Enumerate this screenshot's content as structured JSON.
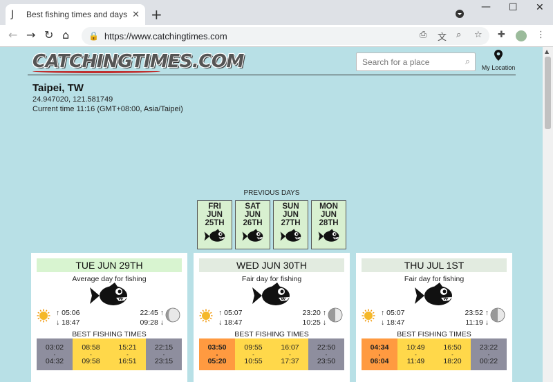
{
  "browser": {
    "tab_title": "Best fishing times and days | Catching",
    "tab_favicon": "fishhook-icon",
    "url": "https://www.catchingtimes.com"
  },
  "site": {
    "logo_text": "CATCHINGTIMES.COM",
    "search_placeholder": "Search for a place",
    "my_location_label": "My Location"
  },
  "location": {
    "name": "Taipei, TW",
    "coords": "24.947020, 121.581749",
    "current_time": "Current time 11:16 (GMT+08:00, Asia/Taipei)"
  },
  "previous_days": {
    "label": "PREVIOUS DAYS",
    "days": [
      {
        "day": "FRI",
        "month": "JUN",
        "date": "25TH"
      },
      {
        "day": "SAT",
        "month": "JUN",
        "date": "26TH"
      },
      {
        "day": "SUN",
        "month": "JUN",
        "date": "27TH"
      },
      {
        "day": "MON",
        "month": "JUN",
        "date": "28TH"
      }
    ]
  },
  "cards": [
    {
      "date": "TUE JUN 29TH",
      "header_color": "#d8f4d0",
      "rating": "Average day for fishing",
      "sunrise": "↑ 05:06",
      "sunset": "↓ 18:47",
      "moonrise": "22:45 ↑",
      "moonset": "09:28 ↓",
      "moon_phase": "waning-gibbous",
      "bft_label": "BEST FISHING TIMES",
      "slots": [
        {
          "start": "03:02",
          "end": "04:32",
          "color": "#8e8e9e",
          "bold": false
        },
        {
          "start": "08:58",
          "end": "09:58",
          "color": "#ffd84a",
          "bold": false
        },
        {
          "start": "15:21",
          "end": "16:51",
          "color": "#ffd84a",
          "bold": false
        },
        {
          "start": "22:15",
          "end": "23:15",
          "color": "#8e8e9e",
          "bold": false
        }
      ]
    },
    {
      "date": "WED JUN 30TH",
      "header_color": "#e2ebe0",
      "rating": "Fair day for fishing",
      "sunrise": "↑ 05:07",
      "sunset": "↓ 18:47",
      "moonrise": "23:20 ↑",
      "moonset": "10:25 ↓",
      "moon_phase": "last-quarter",
      "bft_label": "BEST FISHING TIMES",
      "slots": [
        {
          "start": "03:50",
          "end": "05:20",
          "color": "#ff9a40",
          "bold": true
        },
        {
          "start": "09:55",
          "end": "10:55",
          "color": "#ffd84a",
          "bold": false
        },
        {
          "start": "16:07",
          "end": "17:37",
          "color": "#ffd84a",
          "bold": false
        },
        {
          "start": "22:50",
          "end": "23:50",
          "color": "#8e8e9e",
          "bold": false
        }
      ]
    },
    {
      "date": "THU JUL 1ST",
      "header_color": "#e2ebe0",
      "rating": "Fair day for fishing",
      "sunrise": "↑ 05:07",
      "sunset": "↓ 18:47",
      "moonrise": "23:52 ↑",
      "moonset": "11:19 ↓",
      "moon_phase": "last-quarter",
      "bft_label": "BEST FISHING TIMES",
      "slots": [
        {
          "start": "04:34",
          "end": "06:04",
          "color": "#ff9a40",
          "bold": true
        },
        {
          "start": "10:49",
          "end": "11:49",
          "color": "#ffd84a",
          "bold": false
        },
        {
          "start": "16:50",
          "end": "18:20",
          "color": "#ffd84a",
          "bold": false
        },
        {
          "start": "23:22",
          "end": "00:22",
          "color": "#8e8e9e",
          "bold": false
        }
      ]
    }
  ]
}
